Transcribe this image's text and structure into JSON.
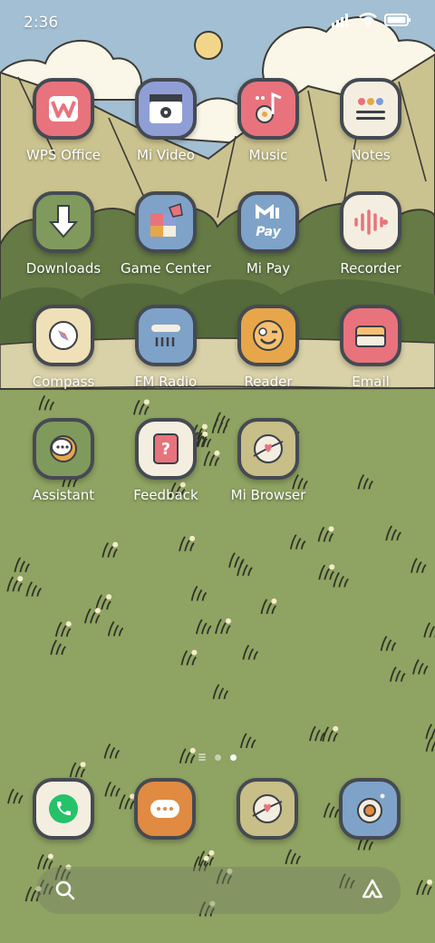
{
  "status_bar": {
    "time": "2:36",
    "icons": [
      "signal-icon",
      "wifi-icon",
      "battery-icon"
    ]
  },
  "apps": [
    {
      "label": "WPS Office",
      "icon": "wps-office-icon",
      "color": "#e8737c"
    },
    {
      "label": "Mi Video",
      "icon": "mi-video-icon",
      "color": "#8f9fd6"
    },
    {
      "label": "Music",
      "icon": "music-icon",
      "color": "#e8737c"
    },
    {
      "label": "Notes",
      "icon": "notes-icon",
      "color": "#f4eee0"
    },
    {
      "label": "Downloads",
      "icon": "downloads-icon",
      "color": "#7f9a5c"
    },
    {
      "label": "Game Center",
      "icon": "game-center-icon",
      "color": "#7fa3c8"
    },
    {
      "label": "Mi Pay",
      "icon": "mi-pay-icon",
      "color": "#7fa3c8"
    },
    {
      "label": "Recorder",
      "icon": "recorder-icon",
      "color": "#f4eee0"
    },
    {
      "label": "Compass",
      "icon": "compass-icon",
      "color": "#efe0b8"
    },
    {
      "label": "FM Radio",
      "icon": "fm-radio-icon",
      "color": "#7fa3c8"
    },
    {
      "label": "Reader",
      "icon": "reader-icon",
      "color": "#e8a64a"
    },
    {
      "label": "Email",
      "icon": "email-icon",
      "color": "#e8737c"
    },
    {
      "label": "Assistant",
      "icon": "assistant-icon",
      "color": "#7f9a5c"
    },
    {
      "label": "Feedback",
      "icon": "feedback-icon",
      "color": "#f4eee0"
    },
    {
      "label": "Mi Browser",
      "icon": "mi-browser-icon",
      "color": "#c7be88"
    }
  ],
  "dock": [
    {
      "icon": "phone-icon",
      "color": "#f4eee0"
    },
    {
      "icon": "messages-icon",
      "color": "#e08a42"
    },
    {
      "icon": "browser-icon",
      "color": "#c7be88"
    },
    {
      "icon": "camera-icon",
      "color": "#7fa3c8"
    }
  ],
  "page_indicator": {
    "pages": 2,
    "current": 2
  },
  "search_bar": {
    "left_icon": "search-icon",
    "right_icon": "assistant-launcher-icon"
  }
}
